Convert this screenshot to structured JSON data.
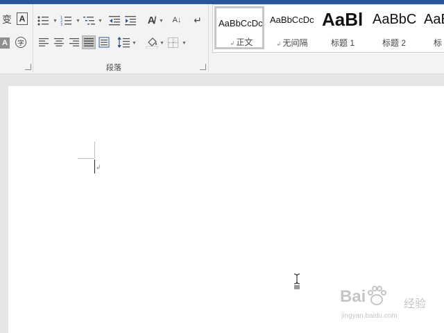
{
  "ribbon": {
    "font_group": {
      "icons": [
        "phonetic-guide-icon",
        "character-border-icon",
        "character-shading-icon",
        "enclose-characters-icon"
      ],
      "character_border_label": "A",
      "shading_label": "A",
      "enclose_label": "字"
    },
    "paragraph_group": {
      "label": "段落",
      "icons": [
        "bullets-icon",
        "numbering-icon",
        "multilevel-list-icon",
        "decrease-indent-icon",
        "increase-indent-icon",
        "chinese-layout-icon",
        "sort-icon",
        "show-marks-icon",
        "align-left-icon",
        "center-icon",
        "align-right-icon",
        "justify-icon",
        "distributed-icon",
        "line-spacing-icon",
        "shading-icon",
        "borders-icon"
      ],
      "justify_selected": true
    },
    "styles_gallery": {
      "items": [
        {
          "preview": "AaBbCcDc",
          "name": "正文",
          "has_mark": true,
          "selected": true
        },
        {
          "preview": "AaBbCcDc",
          "name": "无间隔",
          "has_mark": true,
          "selected": false
        },
        {
          "preview": "AaBl",
          "name": "标题 1",
          "has_mark": false,
          "selected": false
        },
        {
          "preview": "AaBbC",
          "name": "标题 2",
          "has_mark": false,
          "selected": false
        },
        {
          "preview": "AaB",
          "name": "标",
          "has_mark": false,
          "selected": false
        }
      ]
    }
  },
  "document": {
    "paragraph_mark": "↲",
    "cursor": "i-beam"
  },
  "watermark": {
    "brand": "Bai",
    "brand_suffix": "经验",
    "url": "jingyan.baidu.com"
  },
  "colors": {
    "title_bar": "#2b579a",
    "ribbon_bg": "#f3f3f3",
    "workspace_bg": "#e6e6e6",
    "page_bg": "#ffffff"
  }
}
